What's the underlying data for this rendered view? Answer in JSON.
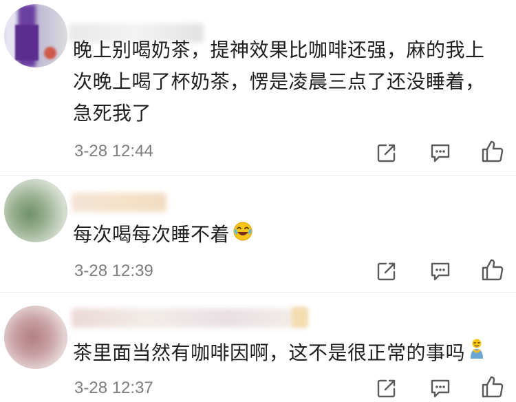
{
  "comments": [
    {
      "text_line1": "晚上别喝奶茶，提神效果比咖啡还强，麻的我上",
      "text_line2": "次晚上喝了杯奶茶，愣是凌晨三点了还没睡着，",
      "text_line3": "急死我了",
      "timestamp": "3-28 12:44",
      "avatar_color": "#6b3fa0"
    },
    {
      "text": "每次喝每次睡不着",
      "emoji": "laughing-crying-emoji",
      "timestamp": "3-28 12:39",
      "avatar_color": "#8aa58a"
    },
    {
      "text": "茶里面当然有咖啡因啊，这不是很正常的事吗",
      "emoji": "thinking-figure-emoji",
      "timestamp": "3-28 12:37",
      "avatar_color": "#c9a2a6"
    }
  ],
  "icons": {
    "share": "share-icon",
    "reply": "reply-comment-icon",
    "like": "thumbs-up-icon"
  },
  "colors": {
    "text": "#1f1f1f",
    "timestamp": "#7d7d7d",
    "icon": "#5a5a5a",
    "emoji_yellow": "#f5c518"
  }
}
